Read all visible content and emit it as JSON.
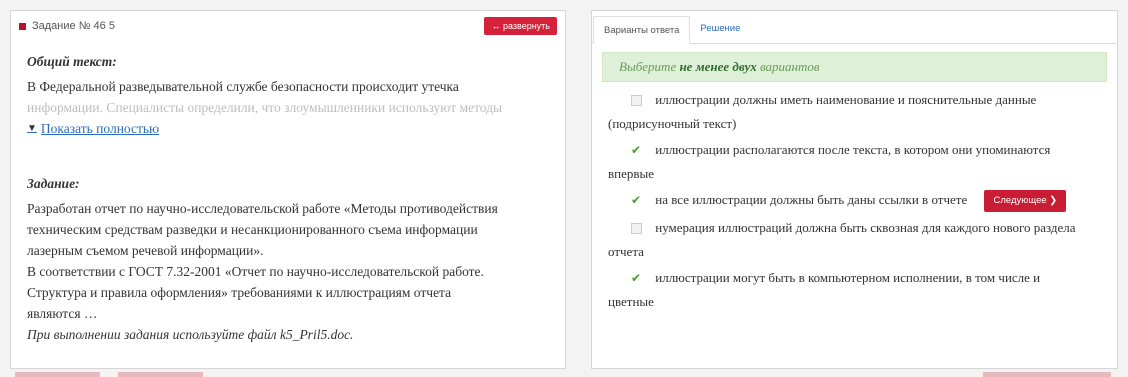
{
  "left": {
    "header_title": "Задание № 46 5",
    "expand_label": "↔ развернуть",
    "general_heading": "Общий текст:",
    "general_line1": "В Федеральной разведывательной службе безопасности происходит утечка",
    "general_line2": "информации. Специалисты определили, что злоумышленники используют методы",
    "show_all_label": "Показать полностью",
    "task_heading": "Задание:",
    "task_lines": [
      "Разработан отчет по научно-исследовательской работе «Методы противодействия",
      "техническим средствам разведки и несанкционированного съема информации",
      "лазерным съемом речевой информации».",
      "В соответствии с ГОСТ 7.32-2001 «Отчет по научно-исследовательской работе.",
      "Структура и правила оформления» требованиями к иллюстрациям отчета",
      "являются …"
    ],
    "note": "При выполнении задания используйте файл k5_Pril5.doc."
  },
  "right": {
    "tabs": [
      "Варианты ответа",
      "Решение"
    ],
    "instruction_pre": "Выберите",
    "instruction_bold": "не менее двух",
    "instruction_post": "вариантов",
    "options": [
      {
        "text": "иллюстрации должны иметь наименование и пояснительные данные",
        "cont": "(подрисуночный текст)",
        "checked": false
      },
      {
        "text": "иллюстрации располагаются после текста, в котором они упоминаются",
        "cont": "впервые",
        "checked": true
      },
      {
        "text": "на все иллюстрации должны быть даны ссылки в отчете",
        "cont": "",
        "checked": true
      },
      {
        "text": "нумерация иллюстраций должна быть сквозная для каждого нового раздела",
        "cont": "отчета",
        "checked": false
      },
      {
        "text": "иллюстрации могут быть в компьютерном исполнении, в том числе и",
        "cont": "цветные",
        "checked": true
      }
    ],
    "next_label": "Следующее ❯"
  }
}
